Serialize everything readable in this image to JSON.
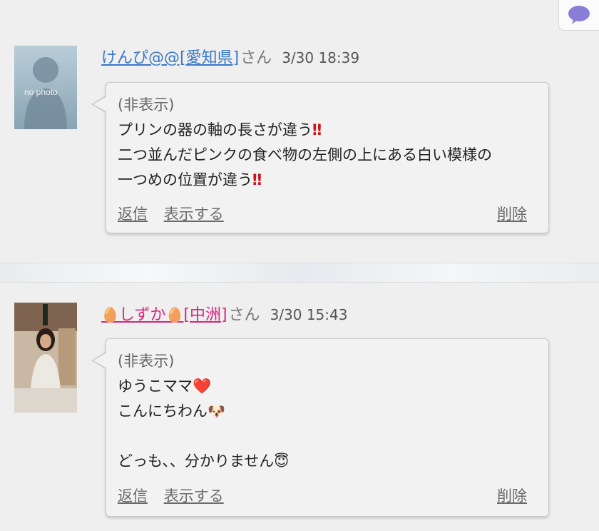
{
  "top_button": {
    "icon": "speech-bubble-icon",
    "color": "#8a7fd8"
  },
  "comments": [
    {
      "user": "けんぴ@@[愛知県]",
      "suffix": "さん",
      "time": "3/30 18:39",
      "avatar": {
        "type": "no-photo",
        "text": "no photo"
      },
      "hidden_label": "(非表示)",
      "lines": [
        "プリンの器の軸の長さが違う",
        "二つ並んだピンクの食べ物の左側の上にある白い模様の",
        "一つめの位置が違う"
      ],
      "emojis": [
        "‼",
        "‼"
      ],
      "actions": {
        "reply": "返信",
        "show": "表示する",
        "delete": "削除"
      },
      "link_color": "#3a78c9"
    },
    {
      "user": "しずか",
      "user_suffix_area": "[中洲]",
      "suffix": "さん",
      "time": "3/30 15:43",
      "avatar": {
        "type": "photo"
      },
      "hidden_label": "(非表示)",
      "lines": [
        "ゆうこママ",
        "こんにちわん",
        "",
        "どっも、、分かりません"
      ],
      "emojis": [
        "❤️",
        "🐶",
        "😇"
      ],
      "actions": {
        "reply": "返信",
        "show": "表示する",
        "delete": "削除"
      },
      "link_color": "#d8257f"
    }
  ]
}
